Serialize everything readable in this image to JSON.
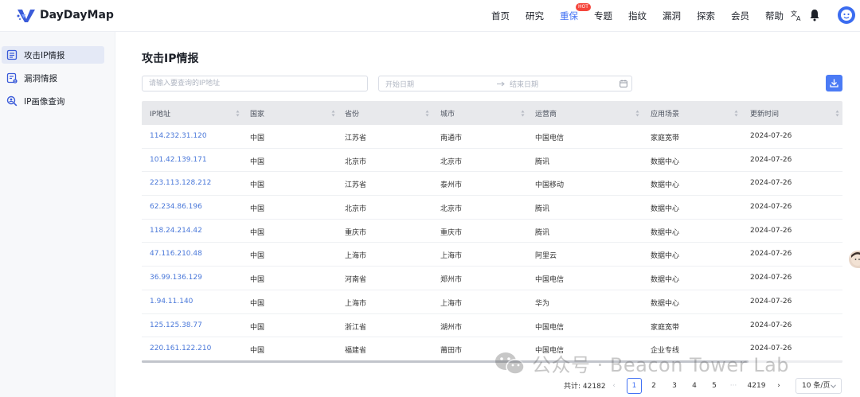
{
  "brand": {
    "name": "DayDayMap",
    "accent": "#4070f4"
  },
  "nav": {
    "items": [
      {
        "label": "首页",
        "active": false
      },
      {
        "label": "研究",
        "active": false
      },
      {
        "label": "重保",
        "active": true,
        "badge": "HOT"
      },
      {
        "label": "专题",
        "active": false
      },
      {
        "label": "指纹",
        "active": false
      },
      {
        "label": "漏洞",
        "active": false
      },
      {
        "label": "探索",
        "active": false
      },
      {
        "label": "会员",
        "active": false
      },
      {
        "label": "帮助",
        "active": false
      }
    ],
    "icons": [
      "translate-icon",
      "bell-icon",
      "user-avatar"
    ]
  },
  "sidebar": {
    "items": [
      {
        "label": "攻击IP情报",
        "icon": "report-icon",
        "active": true
      },
      {
        "label": "漏洞情报",
        "icon": "vuln-report-icon",
        "active": false
      },
      {
        "label": "IP画像查询",
        "icon": "search-profile-icon",
        "active": false
      }
    ]
  },
  "main": {
    "title": "攻击IP情报",
    "ip_search": {
      "placeholder": "请输入要查询的IP地址",
      "value": ""
    },
    "date_range": {
      "start_placeholder": "开始日期",
      "end_placeholder": "结束日期"
    }
  },
  "table": {
    "columns": [
      "IP地址",
      "国家",
      "省份",
      "城市",
      "运营商",
      "应用场景",
      "更新时间"
    ],
    "rows": [
      [
        "114.232.31.120",
        "中国",
        "江苏省",
        "南通市",
        "中国电信",
        "家庭宽带",
        "2024-07-26"
      ],
      [
        "101.42.139.171",
        "中国",
        "北京市",
        "北京市",
        "腾讯",
        "数据中心",
        "2024-07-26"
      ],
      [
        "223.113.128.212",
        "中国",
        "江苏省",
        "泰州市",
        "中国移动",
        "数据中心",
        "2024-07-26"
      ],
      [
        "62.234.86.196",
        "中国",
        "北京市",
        "北京市",
        "腾讯",
        "数据中心",
        "2024-07-26"
      ],
      [
        "118.24.214.42",
        "中国",
        "重庆市",
        "重庆市",
        "腾讯",
        "数据中心",
        "2024-07-26"
      ],
      [
        "47.116.210.48",
        "中国",
        "上海市",
        "上海市",
        "阿里云",
        "数据中心",
        "2024-07-26"
      ],
      [
        "36.99.136.129",
        "中国",
        "河南省",
        "郑州市",
        "中国电信",
        "数据中心",
        "2024-07-26"
      ],
      [
        "1.94.11.140",
        "中国",
        "上海市",
        "上海市",
        "华为",
        "数据中心",
        "2024-07-26"
      ],
      [
        "125.125.38.77",
        "中国",
        "浙江省",
        "湖州市",
        "中国电信",
        "家庭宽带",
        "2024-07-26"
      ],
      [
        "220.161.122.210",
        "中国",
        "福建省",
        "莆田市",
        "中国电信",
        "企业专线",
        "2024-07-26"
      ]
    ]
  },
  "pagination": {
    "total_label": "共计:",
    "total": "42182",
    "prev": "‹",
    "pages": [
      "1",
      "2",
      "3",
      "4",
      "5"
    ],
    "ellipsis": "···",
    "last_page": "4219",
    "next": "›",
    "page_size": "10 条/页",
    "current": "1"
  },
  "watermark": {
    "text": "公众号 · Beacon Tower Lab"
  }
}
